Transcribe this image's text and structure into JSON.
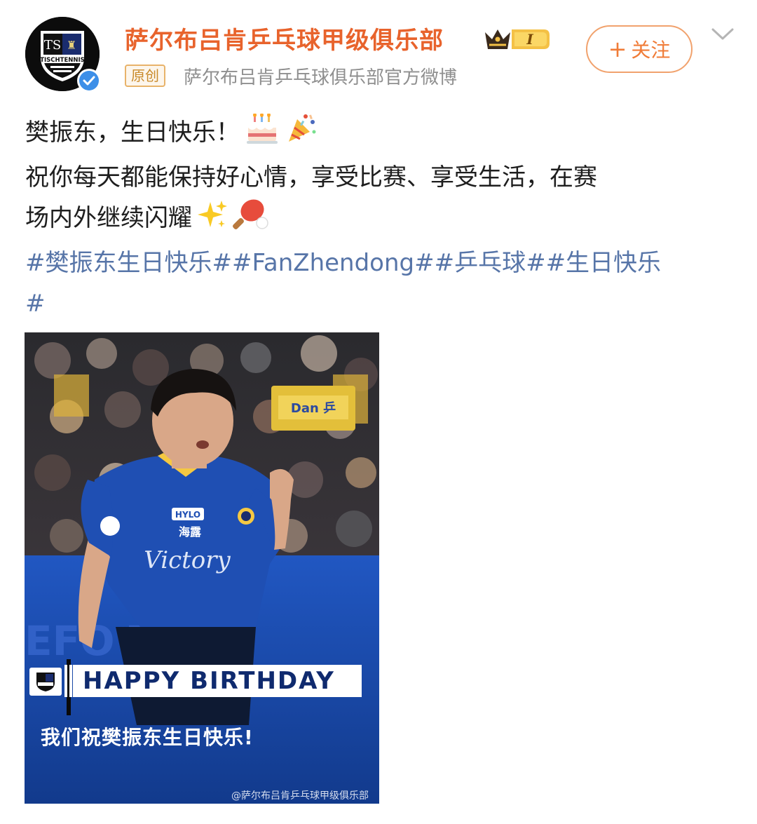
{
  "header": {
    "username": "萨尔布吕肯乒乓球甲级俱乐部",
    "vip_level": "I",
    "tag": "原创",
    "source": "萨尔布吕肯乒乓球俱乐部官方微博",
    "follow_label": "关注",
    "avatar_text": "TISCHTENNIS"
  },
  "post": {
    "line1": "樊振东，生日快乐！",
    "line2": "祝你每天都能保持好心情，享受比赛、享受生活，在赛",
    "line3": "场内外继续闪耀",
    "hashtags_line1": "#樊振东生日快乐##FanZhendong##乒乓球##生日快乐",
    "hashtags_line2": "#",
    "emojis": [
      "birthday-cake-icon",
      "party-popper-icon",
      "sparkles-icon",
      "ping-pong-icon"
    ]
  },
  "image": {
    "banner_title": "HAPPY BIRTHDAY",
    "caption": "我们祝樊振东生日快乐!",
    "watermark": "@萨尔布吕肯乒乓球甲级俱乐部",
    "jersey_sponsor": "Victory",
    "jersey_patch": "HYLO",
    "jersey_chinese": "海露"
  },
  "colors": {
    "username": "#e8632c",
    "hashtag": "#5775a8",
    "follow": "#f07c38",
    "jersey": "#1f4fb3",
    "banner_text": "#0f2a6e"
  }
}
